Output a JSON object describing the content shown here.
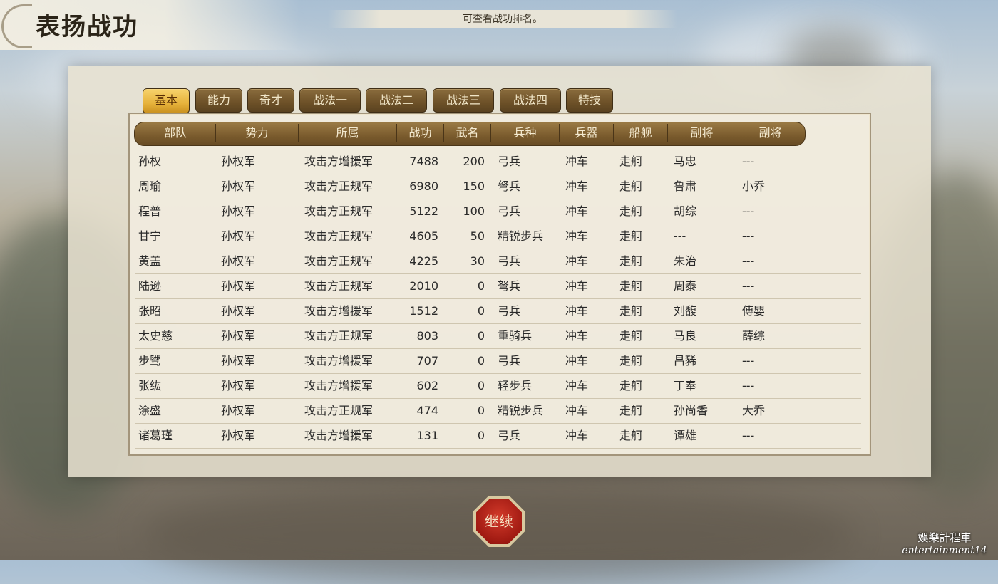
{
  "header": {
    "title": "表扬战功",
    "hint": "可查看战功排名。"
  },
  "tabs": [
    {
      "label": "基本",
      "active": true
    },
    {
      "label": "能力",
      "active": false
    },
    {
      "label": "奇才",
      "active": false
    },
    {
      "label": "战法一",
      "active": false
    },
    {
      "label": "战法二",
      "active": false
    },
    {
      "label": "战法三",
      "active": false
    },
    {
      "label": "战法四",
      "active": false
    },
    {
      "label": "特技",
      "active": false
    }
  ],
  "table": {
    "columns": [
      "部队",
      "势力",
      "所属",
      "战功",
      "武名",
      "兵种",
      "兵器",
      "船舰",
      "副将",
      "副将"
    ],
    "rows": [
      [
        "孙权",
        "孙权军",
        "攻击方增援军",
        "7488",
        "200",
        "弓兵",
        "冲车",
        "走舸",
        "马忠",
        "---"
      ],
      [
        "周瑜",
        "孙权军",
        "攻击方正规军",
        "6980",
        "150",
        "弩兵",
        "冲车",
        "走舸",
        "鲁肃",
        "小乔"
      ],
      [
        "程普",
        "孙权军",
        "攻击方正规军",
        "5122",
        "100",
        "弓兵",
        "冲车",
        "走舸",
        "胡综",
        "---"
      ],
      [
        "甘宁",
        "孙权军",
        "攻击方正规军",
        "4605",
        "50",
        "精锐步兵",
        "冲车",
        "走舸",
        "---",
        "---"
      ],
      [
        "黄盖",
        "孙权军",
        "攻击方正规军",
        "4225",
        "30",
        "弓兵",
        "冲车",
        "走舸",
        "朱治",
        "---"
      ],
      [
        "陆逊",
        "孙权军",
        "攻击方正规军",
        "2010",
        "0",
        "弩兵",
        "冲车",
        "走舸",
        "周泰",
        "---"
      ],
      [
        "张昭",
        "孙权军",
        "攻击方增援军",
        "1512",
        "0",
        "弓兵",
        "冲车",
        "走舸",
        "刘馥",
        "傅嬰"
      ],
      [
        "太史慈",
        "孙权军",
        "攻击方正规军",
        "803",
        "0",
        "重骑兵",
        "冲车",
        "走舸",
        "马良",
        "薛综"
      ],
      [
        "步骘",
        "孙权军",
        "攻击方增援军",
        "707",
        "0",
        "弓兵",
        "冲车",
        "走舸",
        "昌豨",
        "---"
      ],
      [
        "张纮",
        "孙权军",
        "攻击方增援军",
        "602",
        "0",
        "轻步兵",
        "冲车",
        "走舸",
        "丁奉",
        "---"
      ],
      [
        "涂盛",
        "孙权军",
        "攻击方正规军",
        "474",
        "0",
        "精锐步兵",
        "冲车",
        "走舸",
        "孙尚香",
        "大乔"
      ],
      [
        "诸葛瑾",
        "孙权军",
        "攻击方增援军",
        "131",
        "0",
        "弓兵",
        "冲车",
        "走舸",
        "谭雄",
        "---"
      ]
    ]
  },
  "continue_button": {
    "label": "继续"
  },
  "watermark": {
    "line1": "娛樂計程車",
    "line2": "entertainment14"
  }
}
